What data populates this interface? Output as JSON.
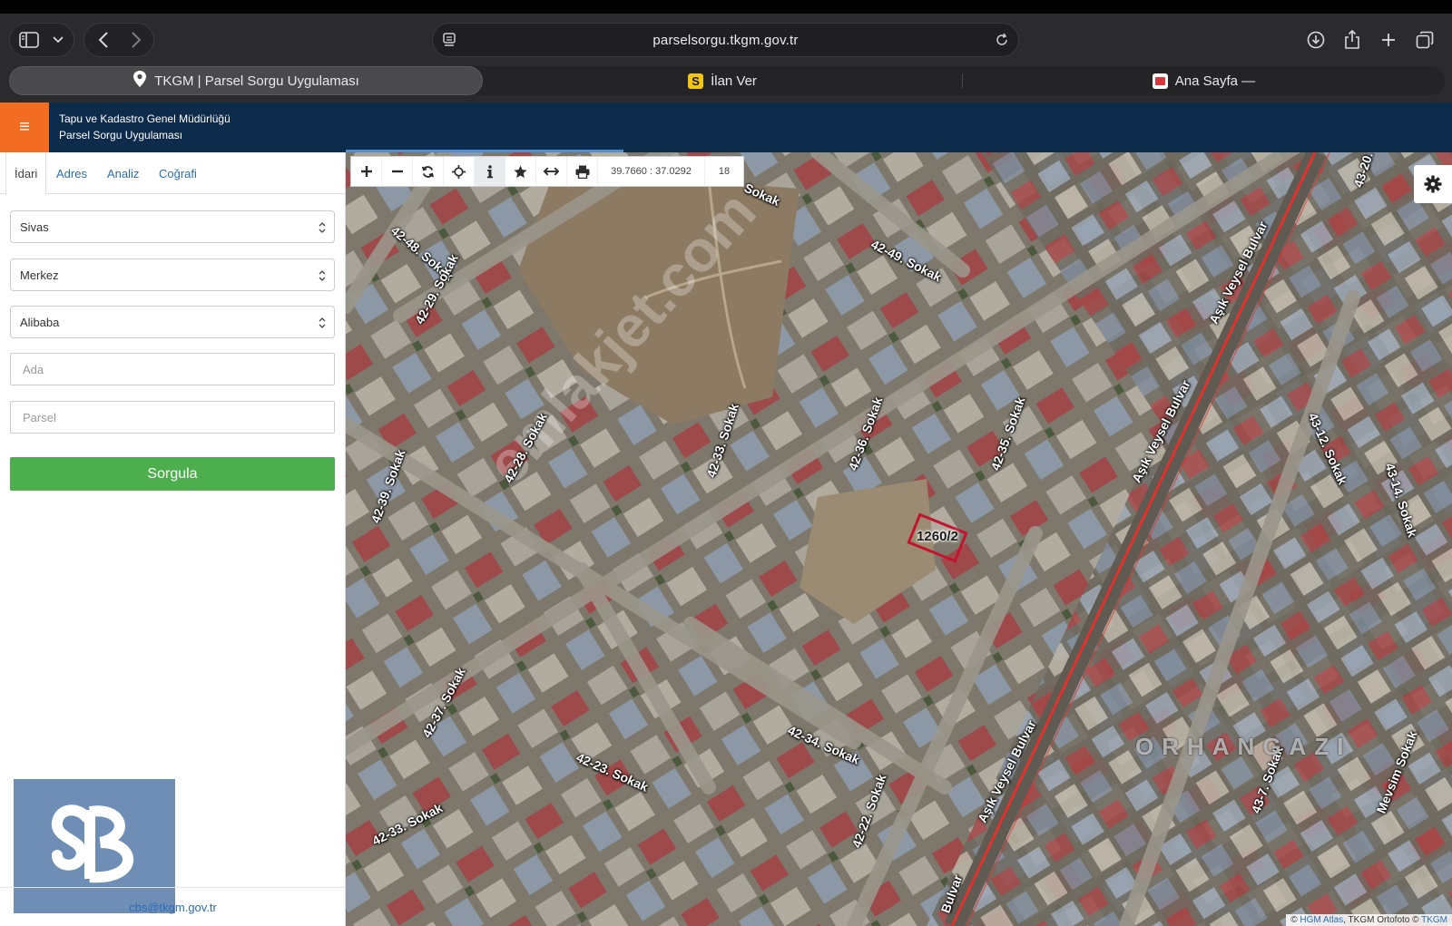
{
  "browser": {
    "url": "parselsorgu.tkgm.gov.tr",
    "tabs": [
      {
        "label": "TKGM | Parsel Sorgu Uygulaması",
        "active": true
      },
      {
        "label": "İlan Ver",
        "active": false
      },
      {
        "label": "Ana Sayfa —",
        "active": false
      }
    ]
  },
  "header": {
    "org": "Tapu ve Kadastro Genel Müdürlüğü",
    "app": "Parsel Sorgu Uygulaması",
    "menu_icon": "≡"
  },
  "sidebar": {
    "tabs": [
      "İdari",
      "Adres",
      "Analiz",
      "Coğrafi"
    ],
    "selects": [
      "Sivas",
      "Merkez",
      "Alibaba"
    ],
    "inputs": [
      {
        "placeholder": "Ada",
        "value": ""
      },
      {
        "placeholder": "Parsel",
        "value": ""
      }
    ],
    "submit": "Sorgula",
    "footer_email": "cbs@tkgm.gov.tr"
  },
  "map": {
    "coords": "39.7660 : 37.0292",
    "zoom": "18",
    "parcel_label": "1260/2",
    "district": "ORHANGAZI",
    "watermark": "emlakjet.com",
    "streets": {
      "s1": "Sokak",
      "s2": "42-48. Sokak",
      "s3": "42-29. Sokak",
      "s4": "42-49. Sokak",
      "s5": "Aşık Veysel Bulvar",
      "s6": "43-20.",
      "s7": "42-28. Sokak",
      "s8": "42-33. Sokak",
      "s9": "42-36. Sokak",
      "s10": "42-35. Sokak",
      "s11": "Aşık Veysel Bulvar",
      "s12": "43-12. Sokak",
      "s13": "43-14. Sokak",
      "s14": "42-39. Sokak",
      "s15": "42-37. Sokak",
      "s16": "42-34. Sokak",
      "s17": "42-23. Sokak",
      "s18": "42-33. Sokak",
      "s19": "42-22. Sokak",
      "s20": "Aşık Veysel Bulvar",
      "s21": "Bulvar",
      "s22": "43-7. Sokak",
      "s23": "Mevsim Sokak"
    },
    "attribution": {
      "prefix": "©",
      "src1": "HGM Atlas",
      "mid": ", TKGM Ortofoto ©",
      "src2": "TKGM"
    },
    "colors": {
      "parcel_border": "#c4122f",
      "road_red": "#e0332b",
      "header_bg": "#0d2b4a",
      "accent_orange": "#f26d22",
      "submit_green": "#4cae4c"
    }
  },
  "icons": [
    "sidebar-icon",
    "chevron-down-icon",
    "back-icon",
    "forward-icon",
    "reader-icon",
    "reload-icon",
    "download-icon",
    "share-icon",
    "new-tab-icon",
    "tabs-overview-icon",
    "location-pin-icon",
    "zoom-in-icon",
    "zoom-out-icon",
    "refresh-icon",
    "crosshair-icon",
    "info-icon",
    "star-icon",
    "measure-icon",
    "print-icon",
    "gear-icon"
  ]
}
